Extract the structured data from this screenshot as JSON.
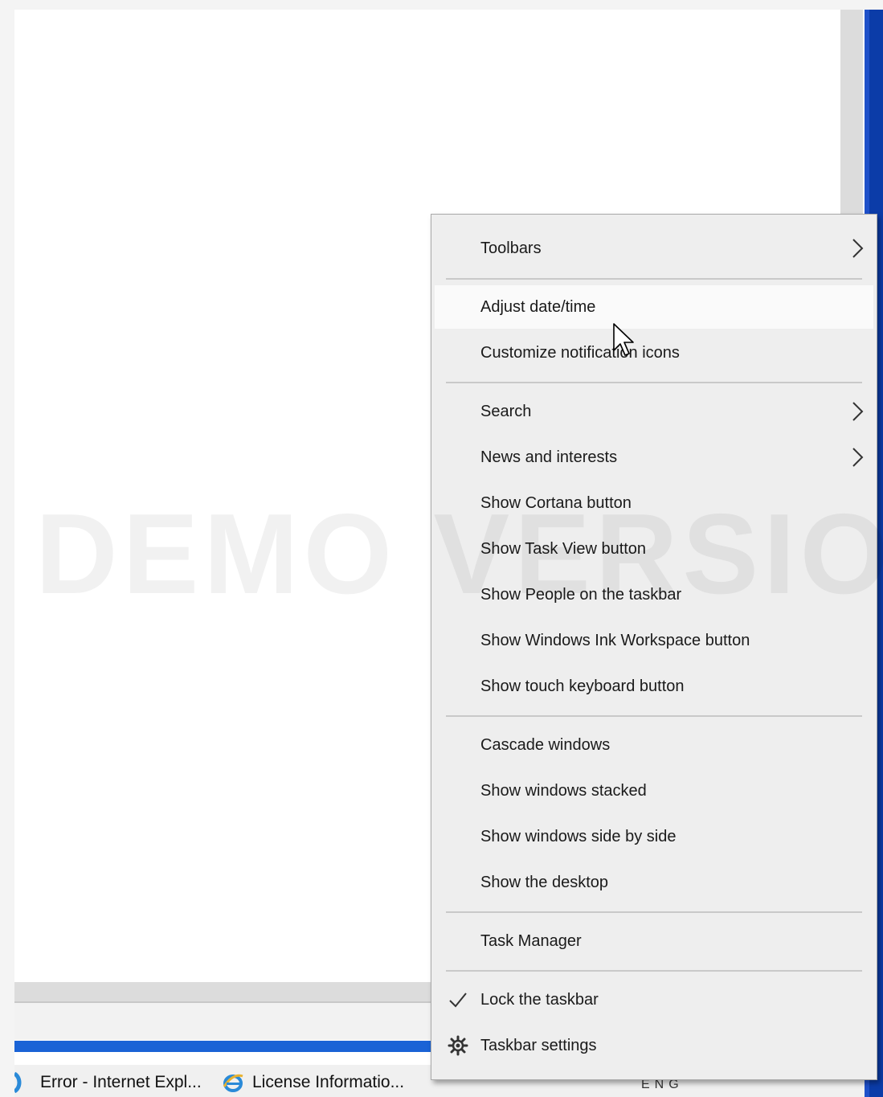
{
  "menu": {
    "items": [
      {
        "label": "Toolbars",
        "submenu": true
      },
      {
        "label": "Adjust date/time"
      },
      {
        "label": "Customize notification icons"
      },
      {
        "label": "Search",
        "submenu": true
      },
      {
        "label": "News and interests",
        "submenu": true
      },
      {
        "label": "Show Cortana button"
      },
      {
        "label": "Show Task View button"
      },
      {
        "label": "Show People on the taskbar"
      },
      {
        "label": "Show Windows Ink Workspace button"
      },
      {
        "label": "Show touch keyboard button"
      },
      {
        "label": "Cascade windows"
      },
      {
        "label": "Show windows stacked"
      },
      {
        "label": "Show windows side by side"
      },
      {
        "label": "Show the desktop"
      },
      {
        "label": "Task Manager"
      },
      {
        "label": "Lock the taskbar",
        "checked": true
      },
      {
        "label": "Taskbar settings",
        "icon": "gear-icon"
      }
    ],
    "hovered_item": "Adjust date/time"
  },
  "watermark": "DEMO VERSION",
  "taskbar": {
    "buttons": [
      {
        "label": "Error - Internet Expl...",
        "icon": "internet-explorer-icon"
      },
      {
        "label": "License Informatio...",
        "icon": "internet-explorer-icon"
      }
    ],
    "tray_text": "ENG"
  },
  "colors": {
    "menu_background": "#eeeeee",
    "hover_background": "#fafafa",
    "taskbar_blue": "#1a63d6",
    "window_edge_blue": "#0b3ca8"
  }
}
